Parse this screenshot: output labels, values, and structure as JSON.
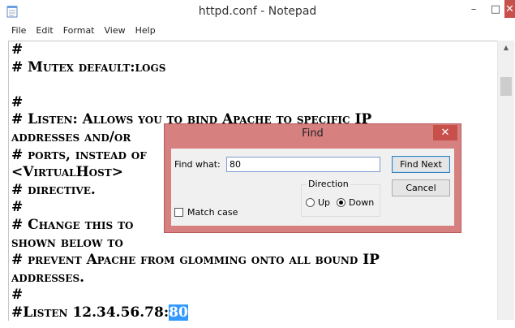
{
  "window": {
    "title": "httpd.conf - Notepad",
    "minimize_glyph": "–",
    "maximize_glyph": "□",
    "close_glyph": "✕"
  },
  "menu": {
    "items": [
      "File",
      "Edit",
      "Format",
      "View",
      "Help"
    ]
  },
  "editor": {
    "lines_before": "#\n# Mutex default:logs\n\n#\n# Listen: Allows you to bind Apache to specific IP\naddresses and/or\n# ports, instead of\n<VirtualHost>\n# directive.\n#\n# Change this to\nshown below to\n# prevent Apache from glomming onto all bound IP\naddresses.\n#\n#Listen 12.34.56.78:",
    "selected_text": "80"
  },
  "find_dialog": {
    "title": "Find",
    "close_glyph": "✕",
    "find_what_label": "Find what:",
    "find_what_value": "80",
    "find_next_label": "Find Next",
    "cancel_label": "Cancel",
    "direction_label": "Direction",
    "up_label": "Up",
    "down_label": "Down",
    "direction_selected": "Down",
    "match_case_label": "Match case",
    "match_case_checked": false
  },
  "icons": {
    "app": "notepad-icon",
    "scroll_up": "scroll-up-arrow-icon"
  },
  "colors": {
    "dialog_frame": "#d78080",
    "close_button": "#c7504b",
    "selection": "#3399ff"
  }
}
